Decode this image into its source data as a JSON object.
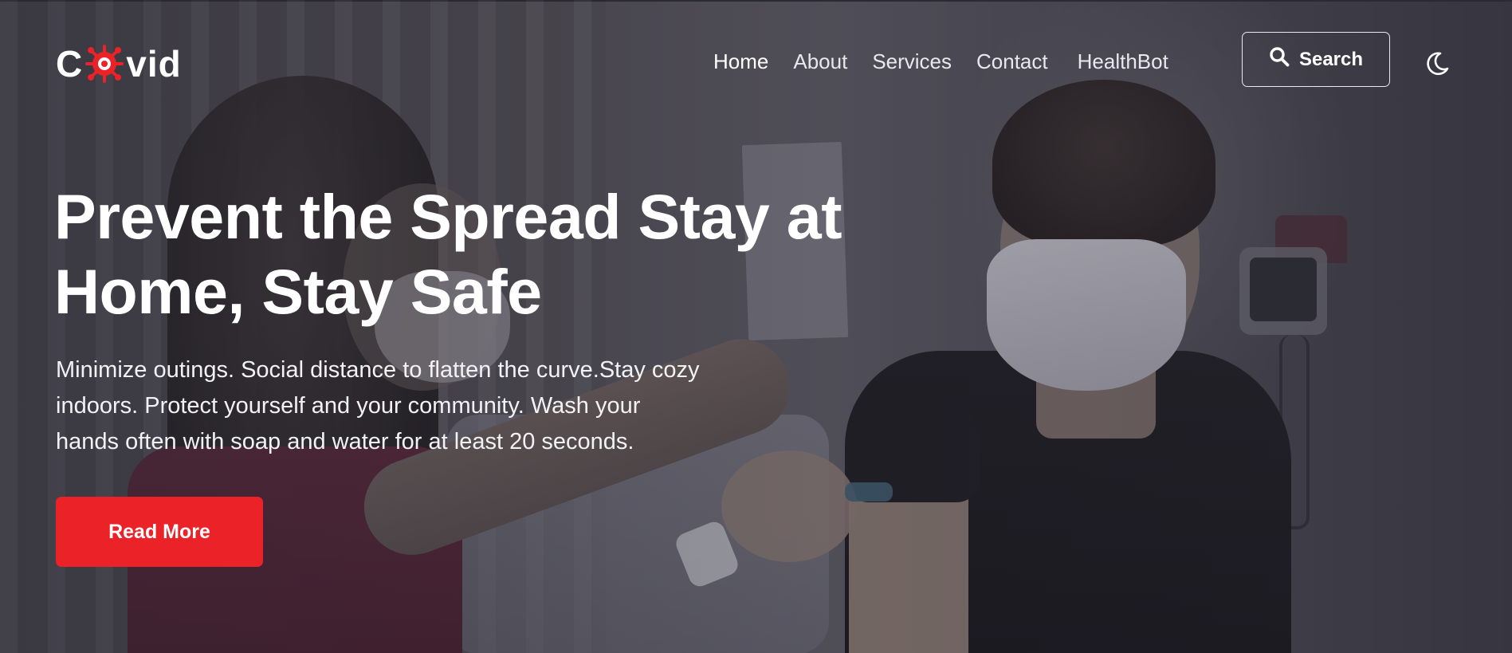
{
  "brand": {
    "name_prefix": "C",
    "name_suffix": "vid",
    "logo_icon": "virus-icon",
    "accent_color": "#eb2227"
  },
  "nav": {
    "items": [
      {
        "label": "Home",
        "active": true
      },
      {
        "label": "About"
      },
      {
        "label": "Services"
      },
      {
        "label": "Contact"
      },
      {
        "label": "HealthBot"
      }
    ]
  },
  "search": {
    "label": "Search",
    "icon": "search-icon"
  },
  "theme_toggle": {
    "icon": "moon-icon"
  },
  "hero": {
    "headline_line1": "Prevent the Spread Stay at",
    "headline_line2": "Home, Stay Safe",
    "subtext_line1": "Minimize outings. Social distance to flatten the curve.Stay cozy",
    "subtext_line2": "indoors. Protect yourself and your community. Wash your",
    "subtext_line3": "hands often with soap and water for at least 20 seconds.",
    "cta_label": "Read More",
    "cta_color": "#eb2227"
  }
}
